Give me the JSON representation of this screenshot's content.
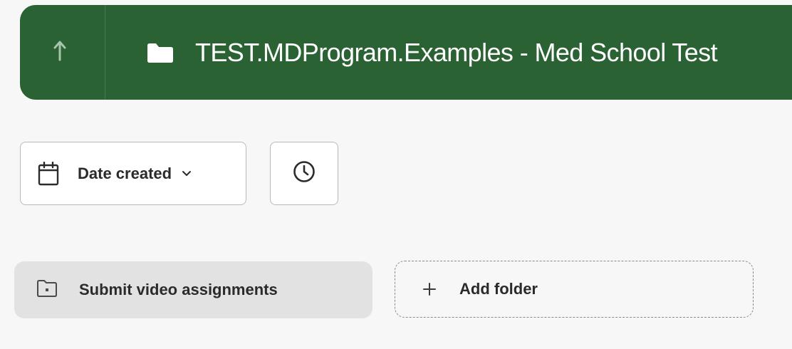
{
  "header": {
    "title": "TEST.MDProgram.Examples - Med School Test",
    "up_icon": "arrow-up-icon",
    "folder_icon": "folder-icon",
    "background_color": "#2a6234"
  },
  "toolbar": {
    "sort_label": "Date created",
    "sort_icon": "calendar-icon",
    "sort_chevron_icon": "chevron-down-icon",
    "recent_icon": "clock-icon"
  },
  "folders": {
    "items": [
      {
        "label": "Submit video assignments",
        "icon": "folder-icon"
      }
    ],
    "add_label": "Add folder",
    "add_icon": "plus-icon"
  }
}
